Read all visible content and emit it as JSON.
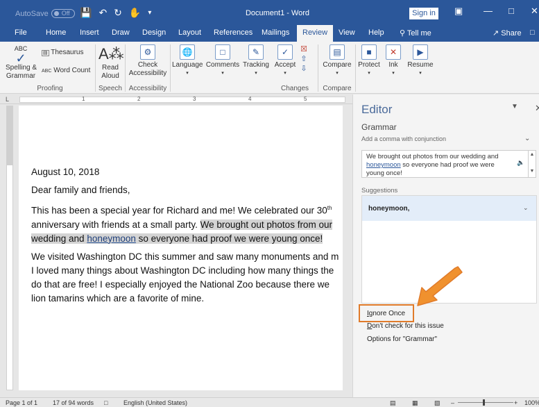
{
  "titlebar": {
    "autosave_label": "AutoSave",
    "autosave_state": "Off",
    "document_title": "Document1 - Word",
    "signin_label": "Sign in"
  },
  "tabs": [
    "File",
    "Home",
    "Insert",
    "Draw",
    "Design",
    "Layout",
    "References",
    "Mailings",
    "Review",
    "View",
    "Help"
  ],
  "active_tab": "Review",
  "tell_me": "Tell me",
  "share_label": "Share",
  "ribbon": {
    "spelling": "Spelling &\nGrammar",
    "thesaurus": "Thesaurus",
    "word_count": "Word Count",
    "read_aloud": "Read\nAloud",
    "check_accessibility": "Check\nAccessibility",
    "language": "Language",
    "comments": "Comments",
    "tracking": "Tracking",
    "accept": "Accept",
    "compare": "Compare",
    "protect": "Protect",
    "ink": "Ink",
    "resume": "Resume",
    "groups": {
      "proofing": "Proofing",
      "speech": "Speech",
      "accessibility": "Accessibility",
      "changes": "Changes",
      "compare": "Compare"
    }
  },
  "ruler": {
    "marks": [
      "1",
      "2",
      "3",
      "4",
      "5"
    ]
  },
  "document": {
    "date": "August 10, 2018",
    "greeting": "Dear family and friends,",
    "p1_line1": "This has been a special year for Richard and me! We celebrated our 30",
    "p1_sup": "th",
    "p1_line2_plain": "anniversary with friends at a small party. ",
    "p1_line2_hl": "We brought out photos from our",
    "p1_line3_a": "wedding and ",
    "p1_line3_word": "honeymoon",
    "p1_line3_b": " so everyone had proof we were young once!",
    "p2_line1": "We visited Washington DC this summer and saw many monuments and m",
    "p2_line2": "I loved many things about Washington DC including how many things the",
    "p2_line3": "do that are free! I especially enjoyed the National Zoo because there we",
    "p2_line4": "lion tamarins which are a favorite of mine."
  },
  "editor": {
    "title": "Editor",
    "category": "Grammar",
    "issue": "Add a comma with conjunction",
    "context_a": "We brought out photos from our wedding and",
    "context_word": "honeymoon",
    "context_b": " so everyone had proof we were",
    "context_c": "young once!",
    "suggestions_label": "Suggestions",
    "suggestion": "honeymoon,",
    "ignore_once_key": "I",
    "ignore_once_rest": "gnore Once",
    "dont_check_key": "D",
    "dont_check_rest": "on't check for this issue",
    "options": "Options for \"Grammar\""
  },
  "status": {
    "page": "Page 1 of 1",
    "words": "17 of 94 words",
    "language": "English (United States)",
    "zoom": "100%"
  },
  "colors": {
    "word_blue": "#2b579a",
    "highlight_orange": "#e07b2a",
    "selection_gray": "#d4d4d4"
  }
}
